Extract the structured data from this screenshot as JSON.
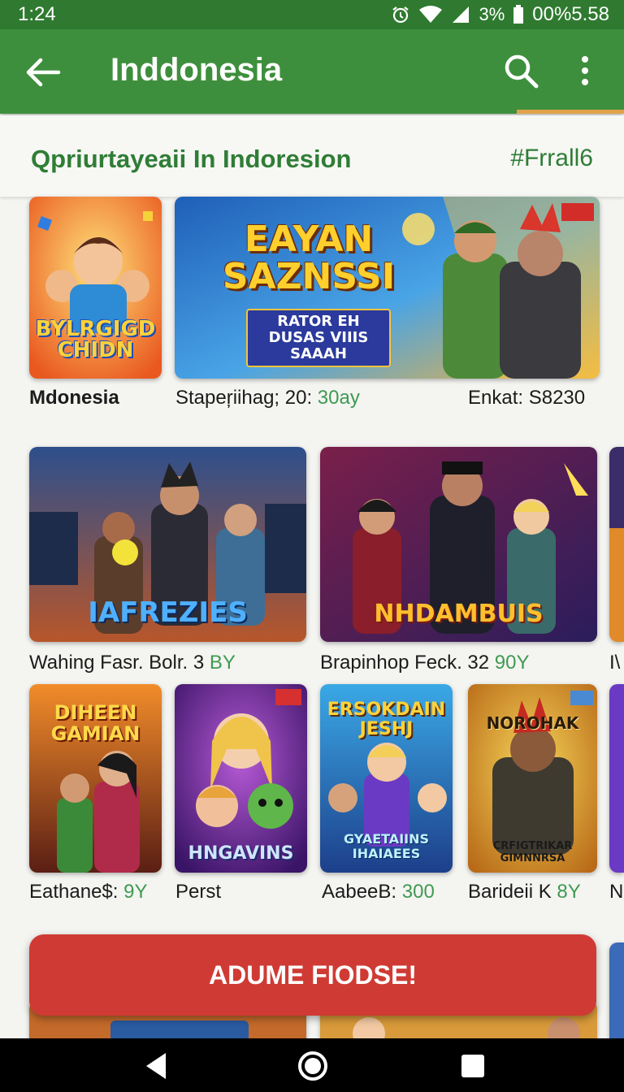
{
  "status": {
    "time": "1:24",
    "indicators": " % ",
    "battery_text": "00%5.58",
    "signal_text": "3%"
  },
  "appbar": {
    "title": "Inddonesia",
    "back_icon": "arrow-left-icon",
    "search_icon": "search-icon",
    "menu_icon": "more-vertical-icon"
  },
  "section": {
    "title": "Qpriurtayeaii In Indoresion",
    "tag": "#Frrall6"
  },
  "row1": [
    {
      "logo": "BYLRGIGD CHIDN",
      "caption": "Mdonesia",
      "count": ""
    },
    {
      "logo": "EAYAN SAZNSSI",
      "sub": "RATOR EH DUSAS VIIIS SAAAH",
      "caption": "Stapeŗiihag; 20:",
      "count": "30ay",
      "caption2": "Enkat: S8230"
    }
  ],
  "row2": [
    {
      "logo": "IAFREZIES",
      "caption": "Wahing Fasr. Bolr. 3",
      "count": "BY"
    },
    {
      "logo": "NHDAMBUIS",
      "caption": "Brapinhop Feck. 32",
      "count": "90Y"
    },
    {
      "caption": "I\\"
    }
  ],
  "row3": [
    {
      "logo": "DIHEEN GAMIAN",
      "caption": "Eathane$:",
      "count": "9Y"
    },
    {
      "logo": "HNGAVINS",
      "caption": "Perst",
      "count": ""
    },
    {
      "logo": "ERSOKDAIN JESHJ",
      "sub": "GYAETAIINS IHAIAEES",
      "caption": "AabeeB:",
      "count": "300"
    },
    {
      "logo": "NOROHAK",
      "sub": "CRFIGTRIKAR GIMNNRSA",
      "caption": "Barideii K",
      "count": "8Y"
    },
    {
      "caption": "N"
    }
  ],
  "cta": {
    "label": "ADUME FIODSE!"
  },
  "colors": {
    "statusbar": "#2f7a30",
    "appbar": "#3e8f3d",
    "accent": "#e0a34a",
    "green_text": "#2f7d36",
    "cta": "#cf3b34"
  }
}
